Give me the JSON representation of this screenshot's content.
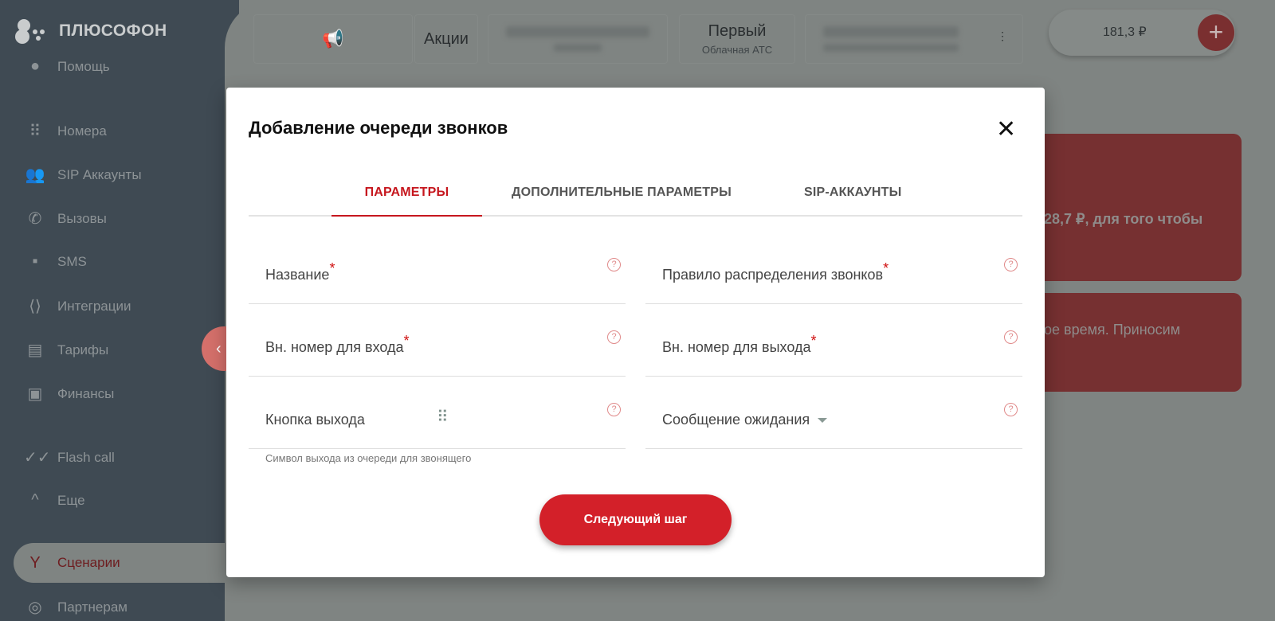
{
  "brand": {
    "name": "ПЛЮСОФОН"
  },
  "sidebar": {
    "items": [
      {
        "label": "Помощь",
        "icon": "help-icon"
      },
      {
        "label": "Номера",
        "icon": "dialpad-icon"
      },
      {
        "label": "SIP Аккаунты",
        "icon": "people-icon"
      },
      {
        "label": "Вызовы",
        "icon": "phone-icon"
      },
      {
        "label": "SMS",
        "icon": "message-icon"
      },
      {
        "label": "Интеграции",
        "icon": "integration-icon"
      },
      {
        "label": "Тарифы",
        "icon": "tariff-icon"
      },
      {
        "label": "Финансы",
        "icon": "wallet-icon"
      },
      {
        "label": "Flash call",
        "icon": "double-check-icon"
      },
      {
        "label": "Еще",
        "icon": "chevron-up-icon"
      },
      {
        "label": "Сценарии",
        "icon": "scenario-icon",
        "active": true
      },
      {
        "label": "Партнерам",
        "icon": "handshake-icon"
      }
    ]
  },
  "header": {
    "promo": "Акции",
    "plan_name": "Первый",
    "plan_type": "Облачная АТС",
    "balance": "181,3 ₽"
  },
  "background_cards": {
    "card1_text": "28,7 ₽, для того чтобы",
    "card2_text": "ое время. Приносим"
  },
  "modal": {
    "title": "Добавление очереди звонков",
    "tabs": [
      {
        "label": "ПАРАМЕТРЫ",
        "active": true
      },
      {
        "label": "ДОПОЛНИТЕЛЬНЫЕ ПАРАМЕТРЫ"
      },
      {
        "label": "SIP-АККАУНТЫ"
      }
    ],
    "fields": {
      "name": "Название",
      "distribution": "Правило распределения звонков",
      "ext_in": "Вн. номер для входа",
      "ext_out": "Вн. номер для выхода",
      "exit_button": "Кнопка выхода",
      "exit_hint": "Символ выхода из очереди для звонящего",
      "hold_message": "Сообщение ожидания"
    },
    "required_mark": "*",
    "next_button": "Следующий шаг"
  },
  "colors": {
    "accent": "#d32029",
    "sidebar": "#3f4a53",
    "overlay": "#7f8482"
  }
}
